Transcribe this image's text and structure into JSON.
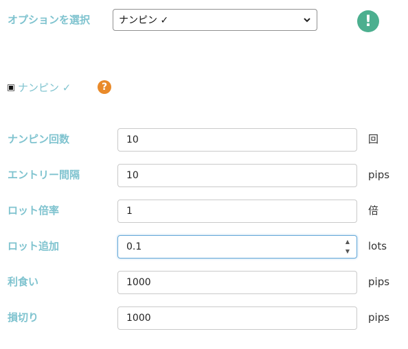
{
  "option_select": {
    "label": "オプションを選択",
    "selected": "ナンピン ✓"
  },
  "status_icons": {
    "warning": "!",
    "help": "?"
  },
  "checkbox": {
    "label": "ナンピン ✓",
    "checked": true
  },
  "fields": [
    {
      "label": "ナンピン回数",
      "value": "10",
      "unit": "回"
    },
    {
      "label": "エントリー間隔",
      "value": "10",
      "unit": "pips"
    },
    {
      "label": "ロット倍率",
      "value": "1",
      "unit": "倍"
    },
    {
      "label": "ロット追加",
      "value": "0.1",
      "unit": "lots"
    },
    {
      "label": "利食い",
      "value": "1000",
      "unit": "pips"
    },
    {
      "label": "損切り",
      "value": "1000",
      "unit": "pips"
    }
  ],
  "colors": {
    "label": "#7fc3cf",
    "warning_icon": "#4caf8f",
    "help_icon": "#e98a2a",
    "focus_border": "#66a9d9"
  }
}
